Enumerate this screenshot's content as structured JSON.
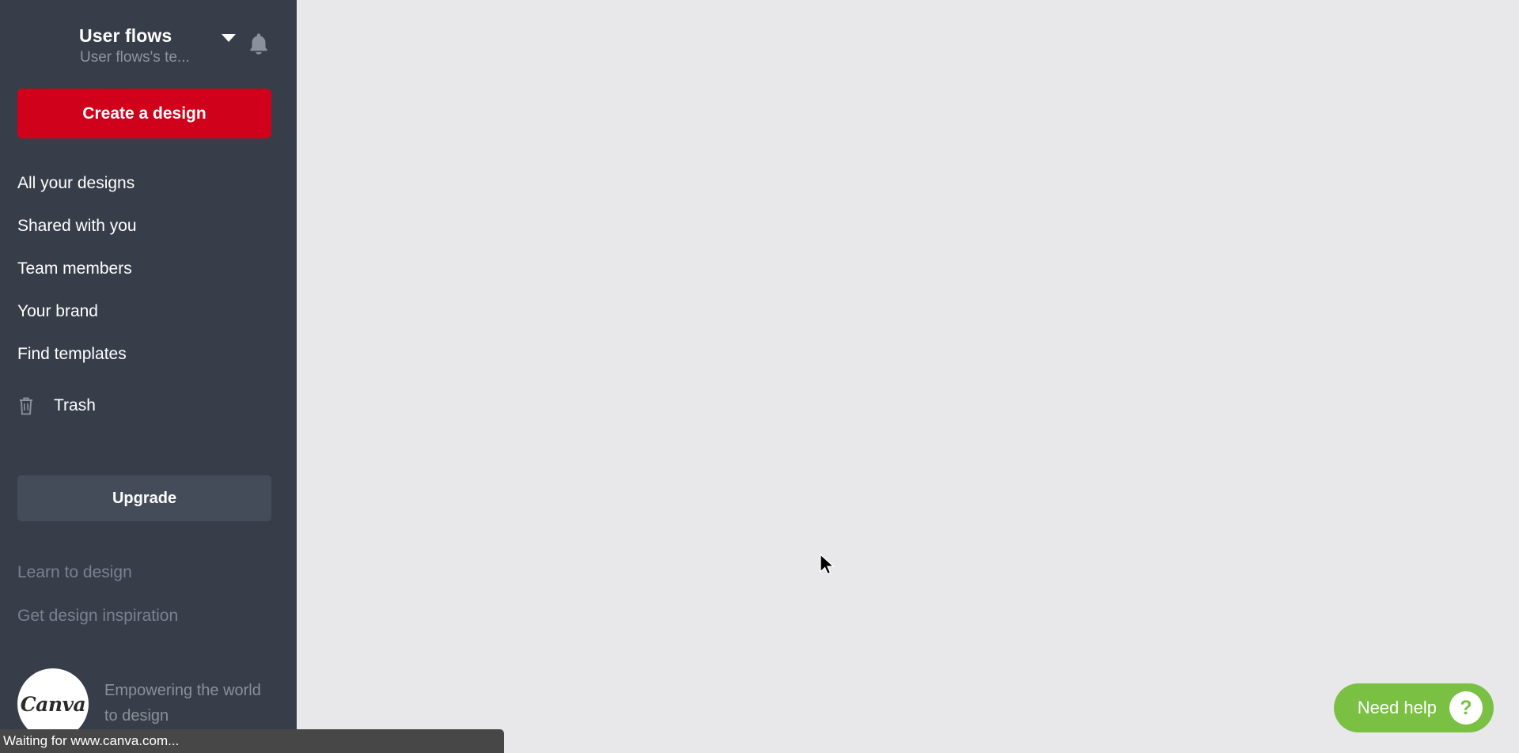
{
  "sidebar": {
    "team": {
      "name": "User flows",
      "subtitle": "User flows's te...",
      "caret_icon": "chevron-down-icon",
      "bell_icon": "bell-icon"
    },
    "create_button": {
      "label": "Create a design"
    },
    "nav_items": [
      {
        "label": "All your designs"
      },
      {
        "label": "Shared with you"
      },
      {
        "label": "Team members"
      },
      {
        "label": "Your brand"
      },
      {
        "label": "Find templates"
      }
    ],
    "trash": {
      "label": "Trash",
      "icon": "trash-icon"
    },
    "upgrade_button": {
      "label": "Upgrade"
    },
    "sub_links": [
      {
        "label": "Learn to design"
      },
      {
        "label": "Get design inspiration"
      }
    ],
    "brand": {
      "wordmark": "Canva",
      "tagline": "Empowering the world to design"
    }
  },
  "main": {
    "need_help": {
      "label": "Need help",
      "question_mark": "?",
      "icon": "question-mark-icon"
    }
  },
  "statusbar": {
    "text": "Waiting for www.canva.com..."
  },
  "colors": {
    "sidebar_bg": "#373d49",
    "canvas_bg": "#e8e8ea",
    "brand_red": "#d0021b",
    "help_green": "#7ac143",
    "upgrade_bg": "#454c59",
    "muted_text": "#7b818e",
    "statusbar_bg": "#474747"
  }
}
